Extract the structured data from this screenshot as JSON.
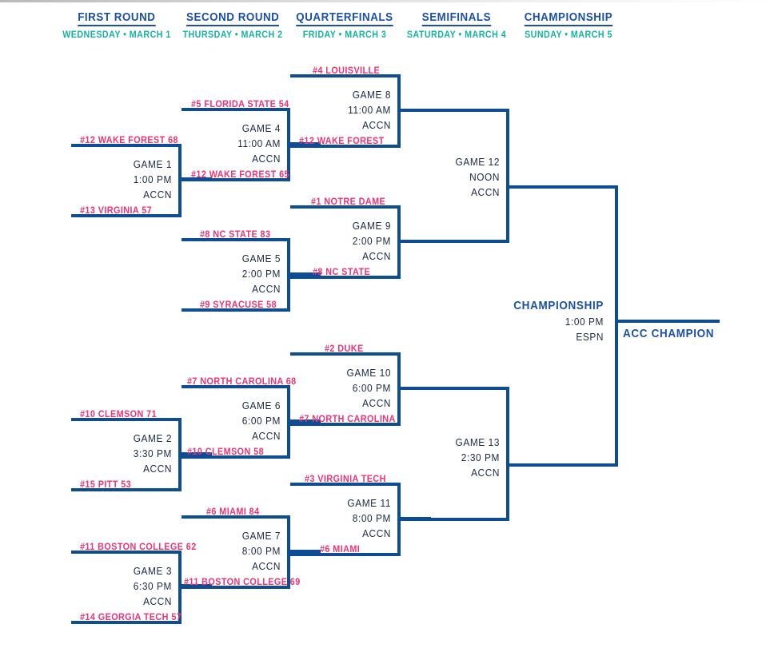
{
  "meta": {
    "accent_navy": "#0d4d96",
    "accent_blue": "#1a50a5",
    "accent_pink": "#ee3377",
    "accent_teal": "#14b3a3",
    "background": "#ffffff"
  },
  "rounds": [
    {
      "name": "FIRST ROUND",
      "date": "WEDNESDAY • MARCH 1"
    },
    {
      "name": "SECOND ROUND",
      "date": "THURSDAY • MARCH 2"
    },
    {
      "name": "QUARTERFINALS",
      "date": "FRIDAY • MARCH 3"
    },
    {
      "name": "SEMIFINALS",
      "date": "SATURDAY • MARCH 4"
    },
    {
      "name": "CHAMPIONSHIP",
      "date": "SUNDAY • MARCH 5"
    }
  ],
  "games": {
    "g1": {
      "label": "GAME 1",
      "time": "1:00 PM",
      "network": "ACCN",
      "top": "#12 WAKE FOREST 68",
      "bottom": "#13 VIRGINIA 57"
    },
    "g2": {
      "label": "GAME 2",
      "time": "3:30 PM",
      "network": "ACCN",
      "top": "#10 CLEMSON 71",
      "bottom": "#15 PITT 53"
    },
    "g3": {
      "label": "GAME 3",
      "time": "6:30 PM",
      "network": "ACCN",
      "top": "#11 BOSTON COLLEGE 62",
      "bottom": "#14 GEORGIA TECH 57"
    },
    "g4": {
      "label": "GAME 4",
      "time": "11:00 AM",
      "network": "ACCN",
      "top": "#5 FLORIDA STATE 54",
      "bottom": "#12 WAKE FOREST 65"
    },
    "g5": {
      "label": "GAME 5",
      "time": "2:00 PM",
      "network": "ACCN",
      "top": "#8 NC STATE 83",
      "bottom": "#9 SYRACUSE 58"
    },
    "g6": {
      "label": "GAME 6",
      "time": "6:00 PM",
      "network": "ACCN",
      "top": "#7 NORTH CAROLINA 68",
      "bottom": "#10 CLEMSON 58"
    },
    "g7": {
      "label": "GAME 7",
      "time": "8:00 PM",
      "network": "ACCN",
      "top": "#6 MIAMI 84",
      "bottom": "#11 BOSTON COLLEGE 69"
    },
    "g8": {
      "label": "GAME 8",
      "time": "11:00 AM",
      "network": "ACCN",
      "top": "#4 LOUISVILLE",
      "bottom": "#12 WAKE FOREST"
    },
    "g9": {
      "label": "GAME 9",
      "time": "2:00 PM",
      "network": "ACCN",
      "top": "#1 NOTRE DAME",
      "bottom": "#8 NC STATE"
    },
    "g10": {
      "label": "GAME 10",
      "time": "6:00 PM",
      "network": "ACCN",
      "top": "#2 DUKE",
      "bottom": "#7 NORTH CAROLINA"
    },
    "g11": {
      "label": "GAME 11",
      "time": "8:00 PM",
      "network": "ACCN",
      "top": "#3 VIRGINIA TECH",
      "bottom": "#6 MIAMI"
    },
    "g12": {
      "label": "GAME 12",
      "time": "NOON",
      "network": "ACCN",
      "top": "",
      "bottom": ""
    },
    "g13": {
      "label": "GAME 13",
      "time": "2:30 PM",
      "network": "ACCN",
      "top": "",
      "bottom": ""
    },
    "final": {
      "label": "CHAMPIONSHIP",
      "time": "1:00 PM",
      "network": "ESPN",
      "winner": "ACC CHAMPION"
    }
  }
}
